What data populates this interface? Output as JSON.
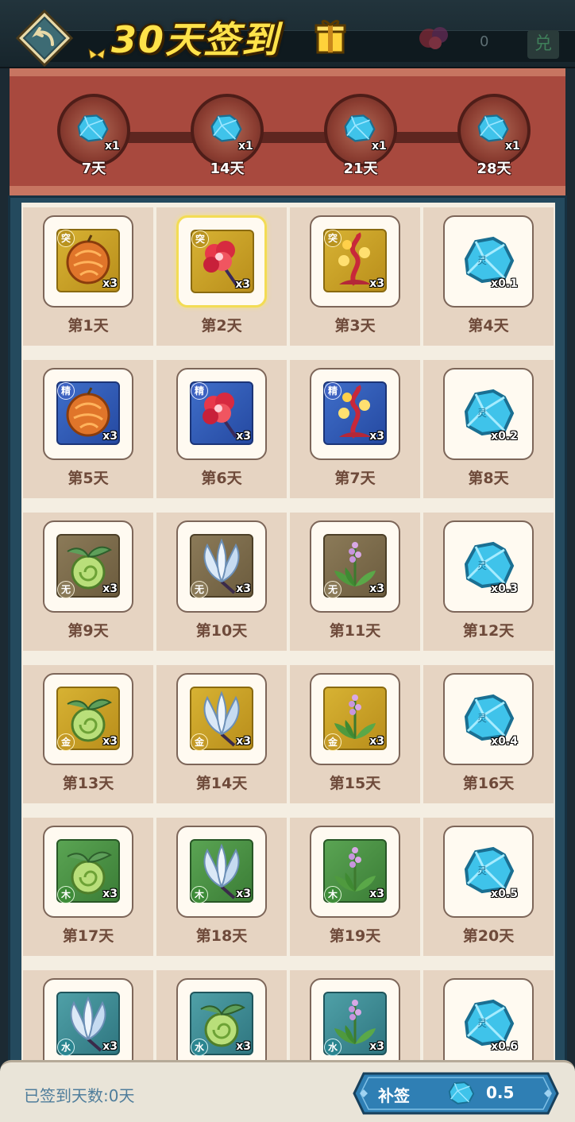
{
  "header": {
    "title": "30天签到",
    "hud_number": "0",
    "exchange_label": "兑"
  },
  "milestones": [
    {
      "qty": "x1",
      "label": "7天"
    },
    {
      "qty": "x1",
      "label": "14天"
    },
    {
      "qty": "x1",
      "label": "21天"
    },
    {
      "qty": "x1",
      "label": "28天"
    }
  ],
  "days": [
    {
      "label": "第1天",
      "item": "fruit",
      "tile": "gold",
      "badge": "突",
      "badge_style": "tu",
      "badge_pos": "top",
      "qty": "x3"
    },
    {
      "label": "第2天",
      "item": "flower",
      "tile": "gold",
      "badge": "突",
      "badge_style": "tu",
      "badge_pos": "top",
      "qty": "x3",
      "selected": true
    },
    {
      "label": "第3天",
      "item": "lantern",
      "tile": "gold",
      "badge": "突",
      "badge_style": "tu",
      "badge_pos": "top",
      "qty": "x3"
    },
    {
      "label": "第4天",
      "item": "gem",
      "tile": "plain",
      "qty": "x0.1"
    },
    {
      "label": "第5天",
      "item": "fruit",
      "tile": "blue",
      "badge": "精",
      "badge_style": "jing",
      "badge_pos": "top",
      "qty": "x3"
    },
    {
      "label": "第6天",
      "item": "flower",
      "tile": "blue",
      "badge": "精",
      "badge_style": "jing",
      "badge_pos": "top",
      "qty": "x3"
    },
    {
      "label": "第7天",
      "item": "lantern",
      "tile": "blue",
      "badge": "精",
      "badge_style": "jing",
      "badge_pos": "top",
      "qty": "x3"
    },
    {
      "label": "第8天",
      "item": "gem",
      "tile": "plain",
      "qty": "x0.2"
    },
    {
      "label": "第9天",
      "item": "melon",
      "tile": "brown",
      "badge": "无",
      "badge_style": "wu",
      "badge_pos": "bottom",
      "qty": "x3"
    },
    {
      "label": "第10天",
      "item": "lotus",
      "tile": "brown",
      "badge": "无",
      "badge_style": "wu",
      "badge_pos": "bottom",
      "qty": "x3"
    },
    {
      "label": "第11天",
      "item": "herb",
      "tile": "brown",
      "badge": "无",
      "badge_style": "wu",
      "badge_pos": "bottom",
      "qty": "x3"
    },
    {
      "label": "第12天",
      "item": "gem",
      "tile": "plain",
      "qty": "x0.3"
    },
    {
      "label": "第13天",
      "item": "melon",
      "tile": "gold",
      "badge": "金",
      "badge_style": "jin",
      "badge_pos": "bottom",
      "qty": "x3"
    },
    {
      "label": "第14天",
      "item": "lotus",
      "tile": "gold",
      "badge": "金",
      "badge_style": "jin",
      "badge_pos": "bottom",
      "qty": "x3"
    },
    {
      "label": "第15天",
      "item": "herb",
      "tile": "gold",
      "badge": "金",
      "badge_style": "jin",
      "badge_pos": "bottom",
      "qty": "x3"
    },
    {
      "label": "第16天",
      "item": "gem",
      "tile": "plain",
      "qty": "x0.4"
    },
    {
      "label": "第17天",
      "item": "melon",
      "tile": "green",
      "badge": "木",
      "badge_style": "mu",
      "badge_pos": "bottom",
      "qty": "x3"
    },
    {
      "label": "第18天",
      "item": "lotus",
      "tile": "green",
      "badge": "木",
      "badge_style": "mu",
      "badge_pos": "bottom",
      "qty": "x3"
    },
    {
      "label": "第19天",
      "item": "herb",
      "tile": "green",
      "badge": "木",
      "badge_style": "mu",
      "badge_pos": "bottom",
      "qty": "x3"
    },
    {
      "label": "第20天",
      "item": "gem",
      "tile": "plain",
      "qty": "x0.5"
    },
    {
      "item": "lotus",
      "tile": "teal",
      "badge": "水",
      "badge_style": "shui",
      "badge_pos": "bottom",
      "qty": "x3"
    },
    {
      "item": "melon",
      "tile": "teal",
      "badge": "水",
      "badge_style": "shui",
      "badge_pos": "bottom",
      "qty": "x3"
    },
    {
      "item": "herb",
      "tile": "teal",
      "badge": "水",
      "badge_style": "shui",
      "badge_pos": "bottom",
      "qty": "x3"
    },
    {
      "item": "gem",
      "tile": "plain",
      "qty": "x0.6"
    }
  ],
  "footer": {
    "signed_days_text": "已签到天数:0天",
    "resign_label": "补签",
    "resign_cost": "0.5"
  },
  "colors": {
    "title_yellow": "#ffe24a",
    "gem_blue": "#3fc3ea",
    "milestone_red": "#a8493e",
    "button_blue": "#2f7fb4"
  }
}
